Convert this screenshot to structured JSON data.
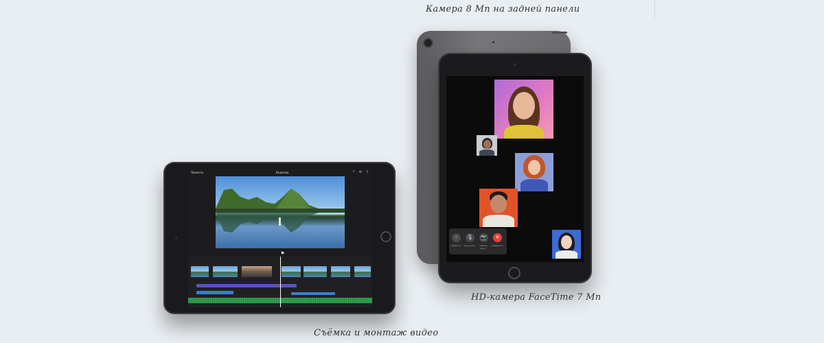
{
  "captions": {
    "rear_camera": "Камера 8 Мп на задней панели",
    "front_camera": "HD-камера FaceTime 7 Мп",
    "video": "Съёмка и монтаж видео"
  },
  "imovie": {
    "back_label": "Проекты",
    "title": "Водопад"
  },
  "facetime": {
    "controls": [
      {
        "icon": "star-icon",
        "glyph": "☆",
        "label": "эффекты"
      },
      {
        "icon": "mic-icon",
        "glyph": "🎙",
        "label": "звук выкл."
      },
      {
        "icon": "camera-icon",
        "glyph": "📷",
        "label": "камера выкл."
      },
      {
        "icon": "end-call-icon",
        "glyph": "✕",
        "label": "завершить"
      }
    ]
  },
  "colors": {
    "background": "#e9eef2",
    "end_call": "#e5413a",
    "track_purple": "#5a52c4",
    "audio_green": "#2f9f4c"
  }
}
